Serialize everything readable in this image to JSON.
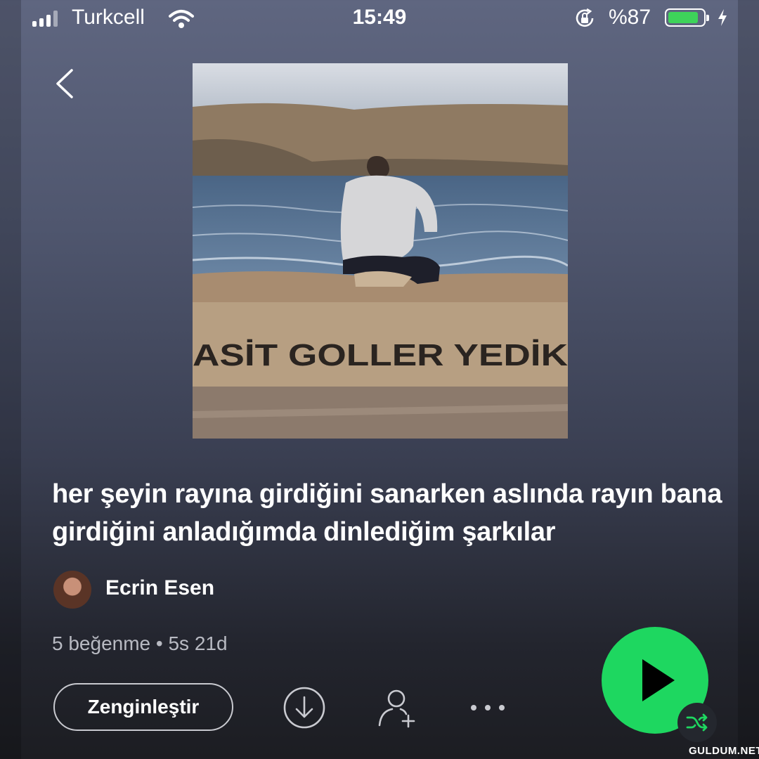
{
  "status_bar": {
    "carrier": "Turkcell",
    "time": "15:49",
    "battery_percent": "%87",
    "battery_level": 0.87,
    "icons": [
      "signal-icon",
      "wifi-icon",
      "orientation-lock-icon",
      "battery-icon",
      "charging-bolt-icon"
    ]
  },
  "nav": {
    "back_icon": "chevron-left-icon"
  },
  "cover": {
    "graffiti_text": "ASİT GOLLER YEDİK"
  },
  "playlist": {
    "title": "her şeyin rayına girdiğini sanarken aslında rayın bana girdiğini anladığımda dinlediğim şarkılar",
    "owner": "Ecrin Esen",
    "meta": "5 beğenme • 5s 21d"
  },
  "actions": {
    "enrich_label": "Zenginleştir",
    "icons": [
      "download-icon",
      "add-user-icon",
      "more-icon",
      "play-icon",
      "shuffle-icon"
    ]
  },
  "colors": {
    "accent": "#1ed760",
    "battery_fill": "#3ed35a",
    "background_top": "#5f6680",
    "background_bottom": "#1c1d22"
  },
  "watermark": "GULDUM.NET"
}
